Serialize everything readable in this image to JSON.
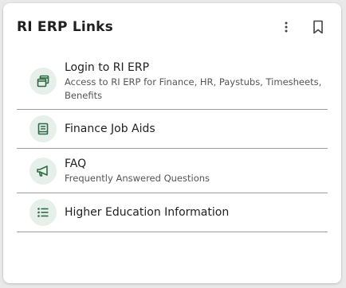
{
  "card": {
    "title": "RI ERP Links"
  },
  "header_actions": {
    "more_icon": "more-vert-icon",
    "bookmark_icon": "bookmark-icon"
  },
  "links": [
    {
      "title": "Login to RI ERP",
      "description": "Access to RI ERP for Finance, HR, Paystubs, Timesheets, Benefits",
      "icon": "windows-icon"
    },
    {
      "title": "Finance Job Aids",
      "icon": "book-icon"
    },
    {
      "title": "FAQ",
      "description": "Frequently Answered Questions",
      "icon": "megaphone-icon"
    },
    {
      "title": "Higher Education Information",
      "icon": "list-icon"
    }
  ],
  "colors": {
    "icon_green": "#2e6b44",
    "icon_bg": "#e6efe9",
    "divider": "#9e9e9e"
  }
}
